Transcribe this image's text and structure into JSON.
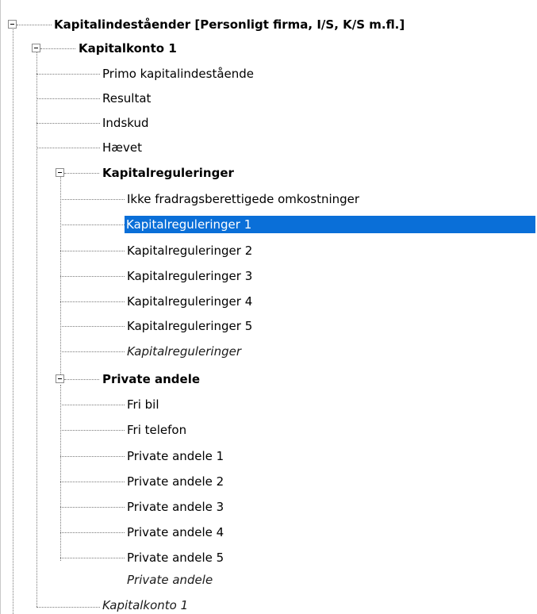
{
  "tree": {
    "root": {
      "label": "Kapitalindeståender [Personligt firma, I/S, K/S m.fl.]",
      "account": {
        "label": "Kapitalkonto 1",
        "items": [
          "Primo kapitalindestående",
          "Resultat",
          "Indskud",
          "Hævet"
        ],
        "kapitalreguleringer": {
          "label": "Kapitalreguleringer",
          "items": [
            "Ikke fradragsberettigede omkostninger",
            "Kapitalreguleringer 1",
            "Kapitalreguleringer 2",
            "Kapitalreguleringer 3",
            "Kapitalreguleringer 4",
            "Kapitalreguleringer 5"
          ],
          "total": "Kapitalreguleringer"
        },
        "private_andele": {
          "label": "Private andele",
          "items": [
            "Fri bil",
            "Fri telefon",
            "Private andele 1",
            "Private andele 2",
            "Private andele 3",
            "Private andele 4",
            "Private andele 5"
          ],
          "total": "Private andele"
        },
        "total": "Kapitalkonto 1"
      }
    },
    "selected": "Kapitalreguleringer 1",
    "colors": {
      "selection": "#0a6fd8",
      "selection_text": "#ffffff"
    }
  }
}
